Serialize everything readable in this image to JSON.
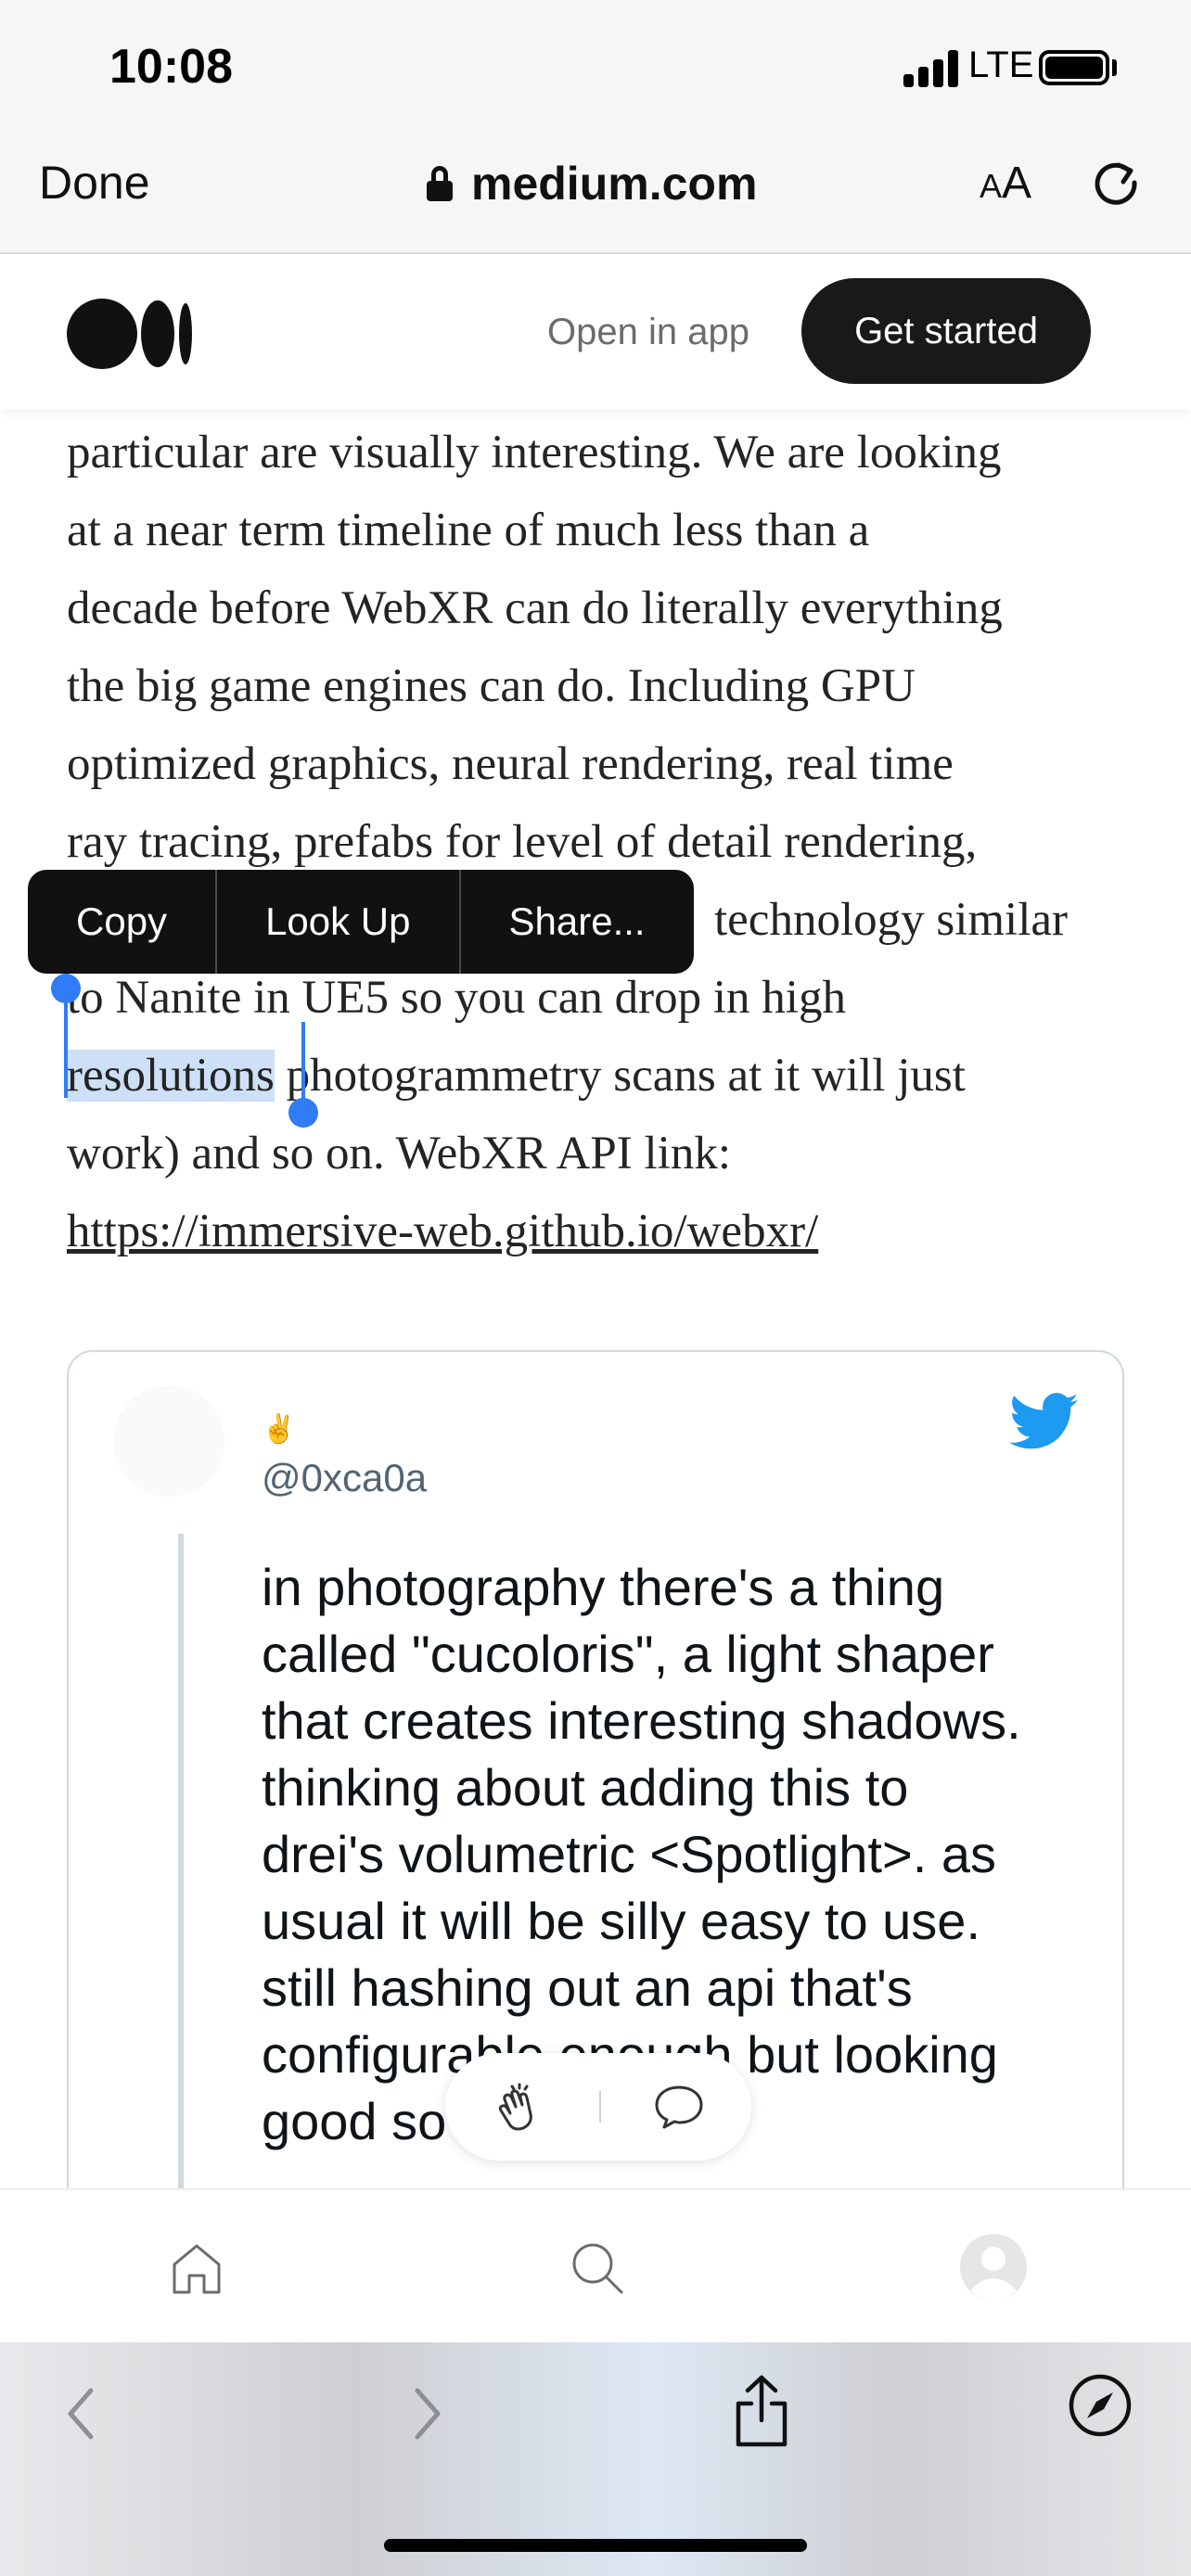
{
  "status_bar": {
    "time": "10:08",
    "network": "LTE"
  },
  "browser": {
    "done_label": "Done",
    "url": "medium.com",
    "text_size_small": "A",
    "text_size_big": "A"
  },
  "header": {
    "open_in_app": "Open in app",
    "get_started": "Get started"
  },
  "article": {
    "line1": "particular are visually interesting. We are looking",
    "line2": "at a near term timeline of much less than a",
    "line3": "decade before WebXR can do literally everything",
    "line4": "the big game engines can do. Including GPU",
    "line5": "optimized graphics, neural rendering, real time",
    "line6": "ray tracing, prefabs for level of detail rendering,",
    "line7_visible": "technology similar",
    "line8": "to Nanite in UE5 so you can drop in high",
    "line9_selected": "resolutions",
    "line9_rest": " photogrammetry scans at it will just",
    "line10": "work) and so on. WebXR API link:",
    "link": "https://immersive-web.github.io/webxr/"
  },
  "edit_menu": {
    "copy": "Copy",
    "look_up": "Look Up",
    "share": "Share..."
  },
  "tweet": {
    "name": "✌",
    "handle": "@0xca0a",
    "lines": [
      "in photography there's a thing",
      "called \"cucoloris\", a light shaper",
      "that creates interesting shadows.",
      "thinking about adding this to",
      "drei's volumetric <Spotlight>. as",
      "usual it will be silly easy to use.",
      "still hashing out an api that's",
      "configurable enough but looking",
      "good so"
    ]
  },
  "colors": {
    "selection": "#cde0f7",
    "handle": "#2f7cf6",
    "twitter": "#1d9bf0",
    "button_dark": "#191919"
  }
}
